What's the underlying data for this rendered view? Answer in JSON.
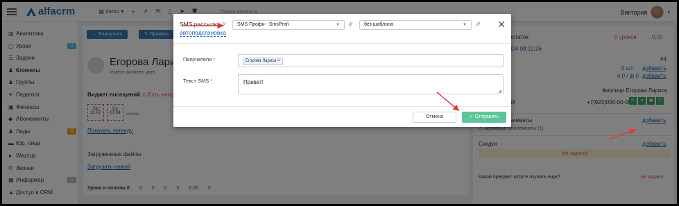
{
  "topbar": {
    "logo": "alfacrm",
    "branch": "demo",
    "tools": [
      "+",
      "⇗",
      "✉",
      "▯",
      "➤",
      "⛊"
    ],
    "search_placeholder": "Поиск клиента",
    "user_name": "Виктория"
  },
  "sidebar": {
    "items": [
      {
        "label": "Аналитика",
        "icon": "chart-icon",
        "glyph": "▥"
      },
      {
        "label": "Уроки",
        "icon": "calendar-icon",
        "glyph": "▢",
        "badge": "2",
        "badge_color": "#5bc0de"
      },
      {
        "label": "Задачи",
        "icon": "tasks-icon",
        "glyph": "☰"
      },
      {
        "label": "Клиенты",
        "icon": "user-icon",
        "glyph": "♟",
        "active": true
      },
      {
        "label": "Группы",
        "icon": "users-icon",
        "glyph": "♟"
      },
      {
        "label": "Педагоги",
        "icon": "teacher-icon",
        "glyph": "✦"
      },
      {
        "label": "Финансы",
        "icon": "money-icon",
        "glyph": "▣"
      },
      {
        "label": "Абонементы",
        "icon": "tag-icon",
        "glyph": "◆"
      },
      {
        "label": "Лиды",
        "icon": "leads-icon",
        "glyph": "♟",
        "badge": "20",
        "badge_color": "#e3a21a"
      },
      {
        "label": "Юр. лица",
        "icon": "briefcase-icon",
        "glyph": "▬"
      },
      {
        "label": "Wazzup",
        "icon": "chat-icon",
        "glyph": "●"
      },
      {
        "label": "Звонки",
        "icon": "phone-icon",
        "glyph": "✆"
      },
      {
        "label": "Информер",
        "icon": "info-icon",
        "glyph": "▦",
        "badge": "9",
        "badge_color": "#bbb"
      },
      {
        "label": "Доступ в CRM",
        "icon": "lock-icon",
        "glyph": "▲"
      }
    ]
  },
  "background": {
    "btn_back": "← Вернуться",
    "btn_edit": "✎ Править",
    "client_name": "Егорова Ларис",
    "client_meta": "клиент  активен  цвет",
    "widget_title": "Виджет посещений",
    "widget_warn": "⚠ Есть непр",
    "day1": "Ср",
    "date1": "31.07",
    "day2": "Ср",
    "date2": "07.08",
    "now_label": "сейчас",
    "legend_link": "Показать легенду",
    "files_title": "Загруженные файлы",
    "upload_link": "Загрузить новый",
    "tabs": [
      "Уроки и оплаты 0",
      "0",
      "0",
      "0",
      "0",
      "0.00",
      "0",
      "",
      ""
    ],
    "right_title": "остаток",
    "right_lessons": "0 уроков",
    "right_amount": "0,00",
    "right_date": "024 08:12:26",
    "right_num": "#4",
    "right_r1": "0 шт",
    "right_add": "добавить",
    "right_r2": "п 0 / ф 0",
    "right_person": "Физлицо Егорова Лариса",
    "right_phone": "+7(923)000-00-00",
    "right_phone_label": "ой",
    "accounts_title": "Счета и абонементы",
    "accounts_sub": "⚠ Архивные абонементы (1)",
    "discounts_title": "Скидки",
    "not_set": "(не задано)",
    "subject_q": "Какой предмет хотите изучать еще?",
    "subject_a": "не задано"
  },
  "modal": {
    "title": "SMS рассылка",
    "link": "автоподстановка",
    "sep": "//",
    "provider": "SMS Профи - SmsProfi",
    "template": "без шаблона",
    "recipients_label": "Получатели",
    "recipient_tag": "Егорова Лариса ×",
    "text_label": "Текст SMS",
    "text_value": "Привет!",
    "cancel": "Отмена",
    "send": "✓ Отправить",
    "required_mark": "*"
  },
  "colors": {
    "brand": "#2b6cb0",
    "send": "#5cc69a",
    "arrow": "#e53935",
    "danger": "#d9534f",
    "link": "#1a5aa6"
  }
}
